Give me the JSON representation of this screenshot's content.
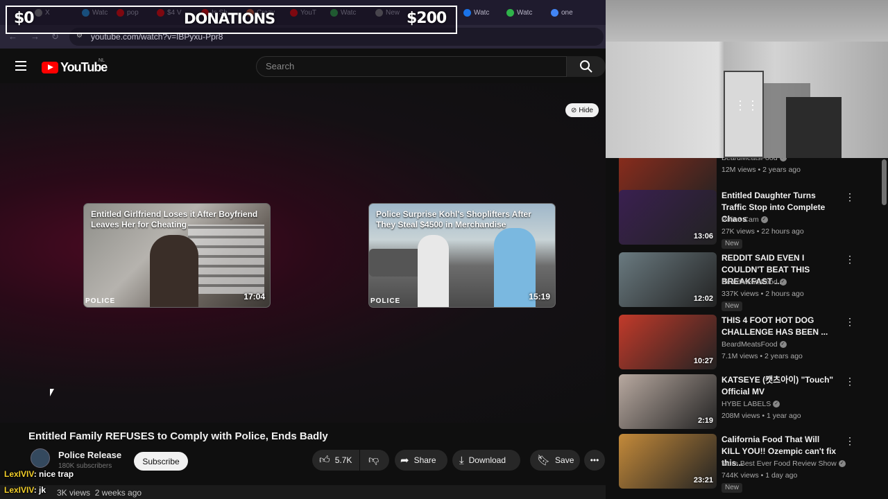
{
  "browser": {
    "tabs": [
      {
        "label": "X",
        "color": "#888888"
      },
      {
        "label": "Watc",
        "color": "#1d9bf0"
      },
      {
        "label": "pop",
        "color": "#ff0000"
      },
      {
        "label": "$4 V",
        "color": "#ff0000"
      },
      {
        "label": "Is Sh",
        "color": "#ff0000"
      },
      {
        "label": "Crazy",
        "color": "#e0643c"
      },
      {
        "label": "YouT",
        "color": "#ff0000"
      },
      {
        "label": "Watc",
        "color": "#2fb34a"
      },
      {
        "label": "New",
        "color": "#888888"
      },
      {
        "label": "Watc",
        "color": "#1a73e8"
      },
      {
        "label": "Watc",
        "color": "#2fb34a"
      },
      {
        "label": "one",
        "color": "#4285f4"
      }
    ],
    "url": "youtube.com/watch?v=IBPyxu-Ppr8"
  },
  "overlay": {
    "donation_current": "$0",
    "donation_title": "DONATIONS",
    "donation_goal": "$200"
  },
  "youtube": {
    "logo_text": "YouTube",
    "country_code": "NL",
    "search_placeholder": "Search"
  },
  "player": {
    "hide_label": "Hide",
    "endcards": [
      {
        "title": "Entitled Girlfriend Loses it After Boyfriend Leaves Her for Cheating",
        "watermark": "POLICE",
        "duration": "17:04"
      },
      {
        "title": "Police Surprise Kohl's Shoplifters After They Steal $4500 in Merchandise",
        "watermark": "POLICE",
        "duration": "15:19"
      }
    ]
  },
  "video": {
    "title": "Entitled Family REFUSES to Comply with Police, Ends Badly",
    "channel": "Police Release",
    "subscribers": "180K subscribers",
    "subscribe_label": "Subscribe",
    "likes": "5.7K",
    "share_label": "Share",
    "download_label": "Download",
    "save_label": "Save",
    "views_partial": "3K views",
    "age": "2 weeks ago"
  },
  "chat": [
    {
      "user": "LexIVIV",
      "message": ": nice trap"
    },
    {
      "user": "LexIVIV",
      "message": ": jk"
    }
  ],
  "sidebar": {
    "items": [
      {
        "title": "",
        "channel": "BeardMeatsFood",
        "meta": "12M views • 2 years ago",
        "duration": "12:07",
        "new": "",
        "thumb": "#8a2c1c"
      },
      {
        "title": "Entitled Daughter Turns Traffic Stop into Complete Chaos",
        "channel": "Police Cam",
        "meta": "27K views • 22 hours ago",
        "duration": "13:06",
        "new": "New",
        "thumb": "#3a2050"
      },
      {
        "title": "REDDIT SAID EVEN I COULDN'T BEAT THIS BREAKFAST ...",
        "channel": "BeardMeatsFood",
        "meta": "337K views • 2 hours ago",
        "duration": "12:02",
        "new": "New",
        "thumb": "#6a7a80"
      },
      {
        "title": "THIS 4 FOOT HOT DOG CHALLENGE HAS BEEN ...",
        "channel": "BeardMeatsFood",
        "meta": "7.1M views • 2 years ago",
        "duration": "10:27",
        "new": "",
        "thumb": "#c23a2a"
      },
      {
        "title": "KATSEYE (캣츠아이) \"Touch\" Official MV",
        "channel": "HYBE LABELS",
        "meta": "208M views • 1 year ago",
        "duration": "2:19",
        "new": "",
        "thumb": "#b8a9a0"
      },
      {
        "title": "California Food That Will KILL YOU!! Ozempic can't fix this...",
        "channel": "More Best Ever Food Review Show",
        "meta": "744K views • 1 day ago",
        "duration": "23:21",
        "new": "New",
        "thumb": "#c48a3a"
      }
    ]
  }
}
